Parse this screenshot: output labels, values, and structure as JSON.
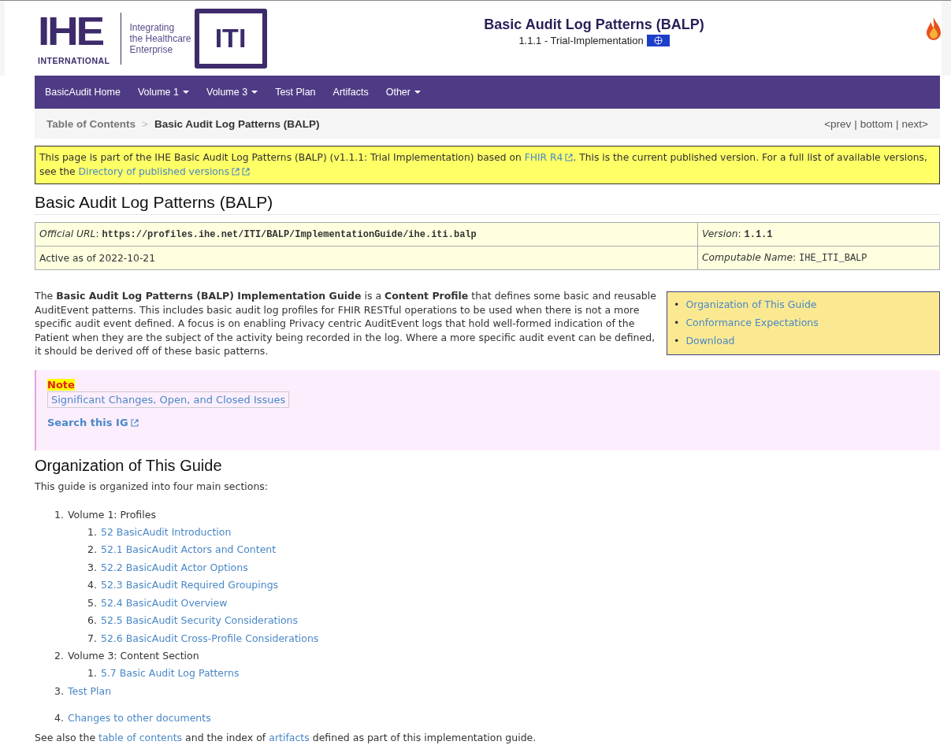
{
  "header": {
    "logo": {
      "letters": "IHE",
      "sub": "INTERNATIONAL",
      "tagline": [
        "Integrating",
        "the Healthcare",
        "Enterprise"
      ],
      "domain": "ITI"
    },
    "title": "Basic Audit Log Patterns (BALP)",
    "version": "1.1.1 - Trial-Implementation"
  },
  "nav": [
    {
      "label": "BasicAudit Home",
      "dropdown": false
    },
    {
      "label": "Volume 1",
      "dropdown": true
    },
    {
      "label": "Volume 3",
      "dropdown": true
    },
    {
      "label": "Test Plan",
      "dropdown": false
    },
    {
      "label": "Artifacts",
      "dropdown": false
    },
    {
      "label": "Other",
      "dropdown": true
    }
  ],
  "breadcrumb": {
    "items": [
      {
        "label": "Table of Contents",
        "selected": false
      },
      {
        "label": "Basic Audit Log Patterns (BALP)",
        "selected": true
      }
    ],
    "separator": ">",
    "pager": [
      "<prev",
      "bottom",
      "next>"
    ],
    "pager_separator": "|"
  },
  "banner": [
    {
      "kind": "text",
      "text": "This page is part of the IHE Basic Audit Log Patterns (BALP) (v1.1.1: Trial Implementation) based on "
    },
    {
      "kind": "link",
      "text": "FHIR R4"
    },
    {
      "kind": "external_icon"
    },
    {
      "kind": "text",
      "text": ". This is the current published version. For a full list of available versions, see the "
    },
    {
      "kind": "link",
      "text": "Directory of published versions"
    },
    {
      "kind": "external_icon"
    },
    {
      "kind": "external_icon"
    }
  ],
  "title": "Basic Audit Log Patterns (BALP)",
  "meta_table": [
    [
      [
        {
          "kind": "label",
          "text": "Official URL"
        },
        {
          "kind": "text",
          "text": ": "
        },
        {
          "kind": "code",
          "text": "https://profiles.ihe.net/ITI/BALP/ImplementationGuide/ihe.iti.balp"
        }
      ],
      [
        {
          "kind": "label",
          "text": "Version"
        },
        {
          "kind": "text",
          "text": ": "
        },
        {
          "kind": "code",
          "text": "1.1.1"
        }
      ]
    ],
    [
      [
        {
          "kind": "text",
          "text": "Active as of 2022-10-21"
        }
      ],
      [
        {
          "kind": "label",
          "text": "Computable Name"
        },
        {
          "kind": "text",
          "text": ": "
        },
        {
          "kind": "code",
          "text": "IHE_ITI_BALP"
        }
      ]
    ]
  ],
  "intro": "The **Basic Audit Log Patterns (BALP) Implementation Guide** is a **Content Profile** that defines some basic and reusable AuditEvent patterns. This includes basic audit log profiles for FHIR RESTful operations to be used when there is not a more specific audit event defined. A focus is on enabling Privacy centric AuditEvent logs that hold well-formed indication of the Patient when they are the subject of the activity being recorded in the log. Where a more specific audit event can be defined, it should be derived off of these basic patterns.",
  "toc_box": [
    {
      "marker": "•",
      "label": "Organization of This Guide"
    },
    {
      "marker": "•",
      "label": "Conformance Expectations"
    },
    {
      "marker": "•",
      "label": "Download"
    }
  ],
  "note": {
    "label": "Note",
    "link": "Significant Changes, Open, and Closed Issues",
    "search": "Search this IG"
  },
  "section": {
    "heading": "Organization of This Guide",
    "lead": "This guide is organized into four main sections:",
    "items": [
      {
        "number": "1.",
        "label": "Volume 1: Profiles",
        "link": false,
        "children": [
          {
            "number": "1.",
            "label": "52 BasicAudit Introduction",
            "link": true
          },
          {
            "number": "2.",
            "label": "52.1 BasicAudit Actors and Content",
            "link": true
          },
          {
            "number": "3.",
            "label": "52.2 BasicAudit Actor Options",
            "link": true
          },
          {
            "number": "4.",
            "label": "52.3 BasicAudit Required Groupings",
            "link": true
          },
          {
            "number": "5.",
            "label": "52.4 BasicAudit Overview",
            "link": true
          },
          {
            "number": "6.",
            "label": "52.5 BasicAudit Security Considerations",
            "link": true
          },
          {
            "number": "7.",
            "label": "52.6 BasicAudit Cross-Profile Considerations",
            "link": true
          }
        ]
      },
      {
        "number": "2.",
        "label": "Volume 3: Content Section",
        "link": false,
        "children": [
          {
            "number": "1.",
            "label": "5.7 Basic Audit Log Patterns",
            "link": true
          }
        ]
      },
      {
        "number": "3.",
        "label": "Test Plan",
        "link": true
      },
      {
        "number": "4.",
        "label": "Changes to other documents",
        "link": true
      }
    ],
    "footer": [
      {
        "kind": "text",
        "text": "See also the "
      },
      {
        "kind": "link",
        "text": "table of contents"
      },
      {
        "kind": "text",
        "text": " and the index of "
      },
      {
        "kind": "link",
        "text": "artifacts"
      },
      {
        "kind": "text",
        "text": " defined as part of this implementation guide."
      }
    ]
  }
}
